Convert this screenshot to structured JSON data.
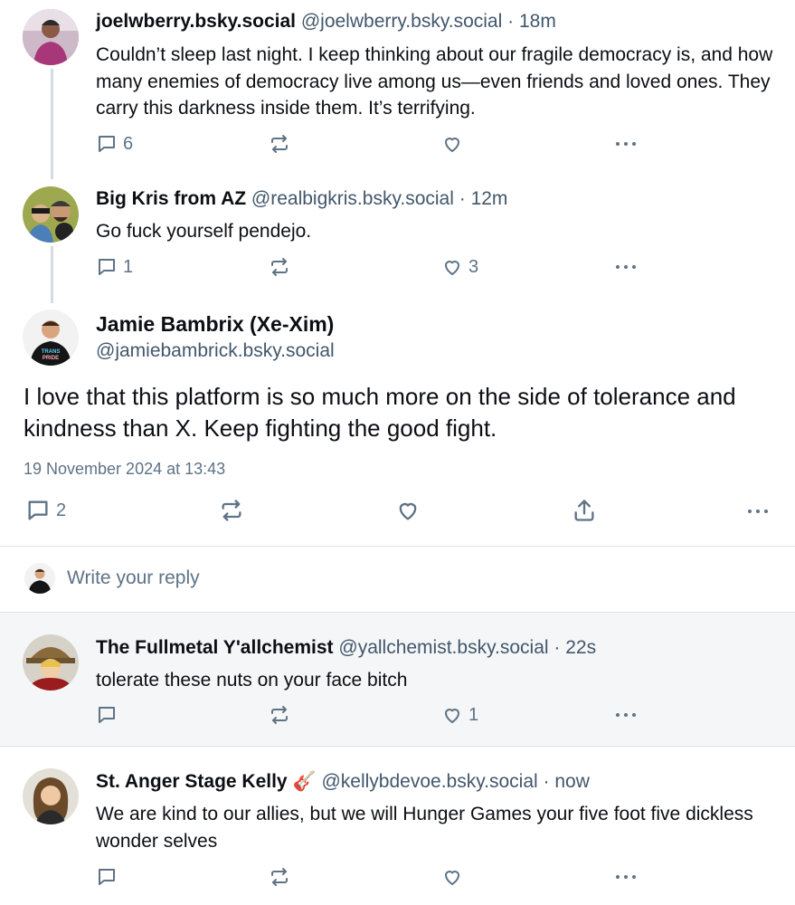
{
  "posts": [
    {
      "name": "joelwberry.bsky.social",
      "handle": "@joelwberry.bsky.social",
      "time": "· 18m",
      "text": "Couldn’t sleep last night. I keep thinking about our fragile democracy is, and how many enemies of democracy live among us—even friends and loved ones. They carry this darkness inside them. It’s terrifying.",
      "replies": "6",
      "reposts": "",
      "likes": ""
    },
    {
      "name": "Big Kris from AZ",
      "handle": "@realbigkris.bsky.social",
      "time": "· 12m",
      "text": "Go fuck yourself pendejo.",
      "replies": "1",
      "reposts": "",
      "likes": "3"
    }
  ],
  "main_post": {
    "name": "Jamie Bambrix (Xe-Xim)",
    "handle": "@jamiebambrick.bsky.social",
    "text": "I love that this platform is so much more on the side of tolerance and kindness than X. Keep fighting the good fight.",
    "timestamp": "19 November 2024 at 13:43",
    "replies": "2",
    "shirt_text_1": "TRANS",
    "shirt_text_2": "PRIDE"
  },
  "reply_box": {
    "placeholder": "Write your reply"
  },
  "replies": [
    {
      "name": "The Fullmetal Y'allchemist",
      "handle": "@yallchemist.bsky.social",
      "time": "· 22s",
      "text": "tolerate these nuts on your face bitch",
      "replies": "",
      "likes": "1"
    },
    {
      "name": "St. Anger Stage Kelly",
      "name_emoji": "🎸",
      "handle": "@kellybdevoe.bsky.social",
      "time": "· now",
      "text": "We are kind to our allies, but we will Hunger Games your five foot five dickless wonder selves",
      "replies": "",
      "likes": ""
    }
  ],
  "colors": {
    "text": "#0b0f14",
    "muted": "#42576c",
    "icon": "#5f7286",
    "thread_line": "#d4dbe2",
    "highlight_bg": "#f5f6f7"
  },
  "icons": [
    "reply-icon",
    "repost-icon",
    "like-icon",
    "share-icon",
    "more-icon"
  ]
}
